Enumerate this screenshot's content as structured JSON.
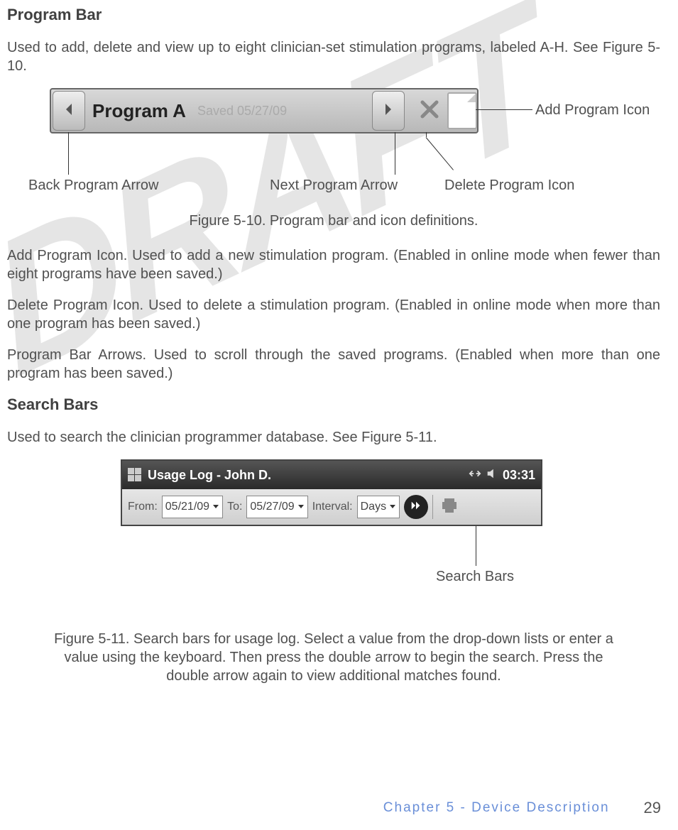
{
  "watermark": "DRAFT",
  "section1": {
    "heading": "Program Bar",
    "intro": "Used to add, delete and view up to eight clinician-set stimulation programs, labeled A-H. See Figure 5-10."
  },
  "fig1": {
    "program_label": "Program A",
    "saved_text": "Saved 05/27/09",
    "callouts": {
      "add": "Add Program Icon",
      "back": "Back Program Arrow",
      "next": "Next Program Arrow",
      "delete": "Delete Program Icon"
    },
    "caption": "Figure 5-10. Program bar and icon definitions."
  },
  "paras": {
    "add": "Add Program Icon. Used to add a new stimulation program. (Enabled in online mode when fewer than eight programs have been saved.)",
    "del": "Delete Program Icon. Used to delete a stimulation program. (Enabled in online mode when more than one program has been saved.)",
    "arrows": "Program Bar Arrows. Used to scroll through the saved programs. (Enabled when more than one program has been saved.)"
  },
  "section2": {
    "heading": "Search Bars",
    "intro": "Used to search the clinician programmer database. See Figure 5-11."
  },
  "fig2": {
    "title": "Usage Log - John D.",
    "clock": "03:31",
    "from_label": "From:",
    "from_value": "05/21/09",
    "to_label": "To:",
    "to_value": "05/27/09",
    "interval_label": "Interval:",
    "interval_value": "Days",
    "callout": "Search Bars",
    "caption": "Figure 5-11. Search bars for usage log. Select a value from the drop-down lists or enter a value using the keyboard. Then press the double arrow to begin the search. Press the double arrow again to view additional matches found."
  },
  "footer": {
    "chapter": "Chapter 5 - Device Description",
    "page": "29"
  }
}
